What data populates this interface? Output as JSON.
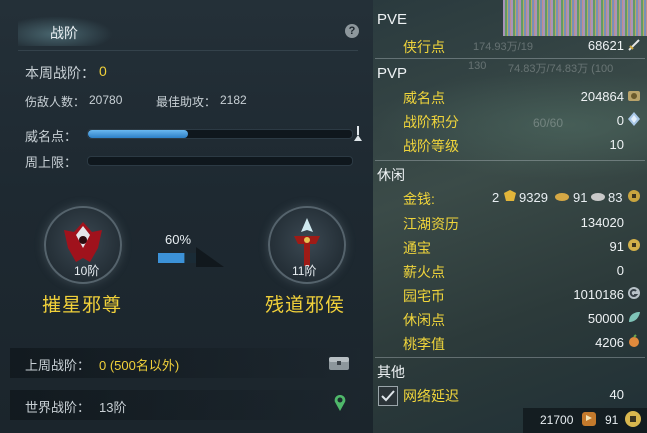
{
  "left": {
    "tab_title": "战阶",
    "help_label": "?",
    "weekly_rank_label": "本周战阶：",
    "weekly_rank_value": "0",
    "kills_label": "伤敌人数：",
    "kills_value": "20780",
    "assists_label": "最佳助攻：",
    "assists_value": "2182",
    "fame_label": "威名点：",
    "fame_progress": 0.38,
    "weekly_cap_label": "周上限：",
    "weekly_cap_progress": 0.0,
    "rank_left": {
      "level": "10阶",
      "name": "摧星邪尊"
    },
    "rank_right": {
      "level": "11阶",
      "name": "残道邪侯"
    },
    "progress_percent_text": "60%",
    "progress_percent": 0.6,
    "last_week_label": "上周战阶：",
    "last_week_value": "0 (500名以外)",
    "world_rank_label": "世界战阶：",
    "world_rank_value": "13阶"
  },
  "right": {
    "pve_header": "PVE",
    "xiaxing_label": "侠行点",
    "xiaxing_value": "68621",
    "pvp_header": "PVP",
    "weiming_label": "威名点",
    "weiming_value": "204864",
    "zhanjie_score_label": "战阶积分",
    "zhanjie_score_value": "0",
    "zhanjie_level_label": "战阶等级",
    "zhanjie_level_value": "10",
    "bg_text_1": "174.93万/19",
    "bg_text_2": "130",
    "bg_text_3": "74.83万/74.83万 (100",
    "bg_text_4": "60/60",
    "leisure_header": "休闲",
    "money_label": "金钱:",
    "money_gold": "2",
    "money_silver": "9329",
    "money_copper": "91",
    "money_extra": "83",
    "jianghu_label": "江湖资历",
    "jianghu_value": "134020",
    "tongbao_label": "通宝",
    "tongbao_value": "91",
    "xinhuo_label": "薪火点",
    "xinhuo_value": "0",
    "yuanzhai_label": "园宅币",
    "yuanzhai_value": "1010186",
    "xiuxian_label": "休闲点",
    "xiuxian_value": "50000",
    "taoli_label": "桃李值",
    "taoli_value": "4206",
    "other_header": "其他",
    "latency_label": "网络延迟",
    "latency_value": "40",
    "footer_value1": "21700",
    "footer_value2": "91"
  },
  "colors": {
    "accent_yellow": "#f1d13a",
    "bar_blue": "#3c92d8"
  }
}
